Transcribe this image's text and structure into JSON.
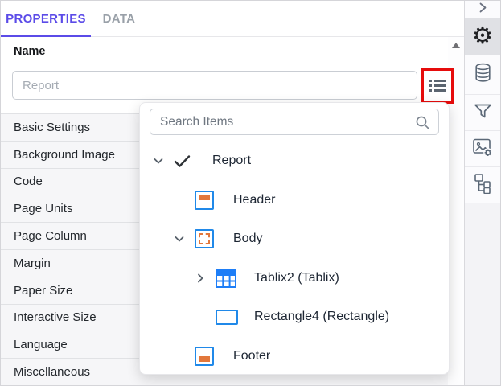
{
  "header": {
    "tabs": [
      {
        "label": "PROPERTIES",
        "active": true
      },
      {
        "label": "DATA",
        "active": false
      }
    ]
  },
  "name_field": {
    "label": "Name",
    "value": "",
    "placeholder": "Report"
  },
  "property_sections": [
    "Basic Settings",
    "Background Image",
    "Code",
    "Page Units",
    "Page Column",
    "Margin",
    "Paper Size",
    "Interactive Size",
    "Language",
    "Miscellaneous"
  ],
  "item_dropdown": {
    "search_placeholder": "Search Items",
    "tree": [
      {
        "label": "Report",
        "level": 0,
        "state": "expanded",
        "icon": "checkmark"
      },
      {
        "label": "Header",
        "level": 1,
        "state": "leaf",
        "icon": "header-icon"
      },
      {
        "label": "Body",
        "level": 1,
        "state": "expanded",
        "icon": "body-icon"
      },
      {
        "label": "Tablix2 (Tablix)",
        "level": 2,
        "state": "collapsed",
        "icon": "tablix-icon"
      },
      {
        "label": "Rectangle4 (Rectangle)",
        "level": 2,
        "state": "leaf",
        "icon": "rectangle-icon"
      },
      {
        "label": "Footer",
        "level": 1,
        "state": "leaf",
        "icon": "footer-icon"
      }
    ]
  },
  "sidebar": {
    "active_icon": "settings",
    "icons": [
      "collapse-chevron",
      "settings",
      "data-source",
      "filter",
      "image-settings",
      "hierarchy"
    ]
  },
  "colors": {
    "accent_purple": "#5b4be8",
    "inactive_tab_gray": "#99a0a8",
    "item_blue": "#2089e9",
    "tablix_blue": "#1e7ef7",
    "item_orange": "#e2773b",
    "annotation_red": "#e60c0c"
  }
}
